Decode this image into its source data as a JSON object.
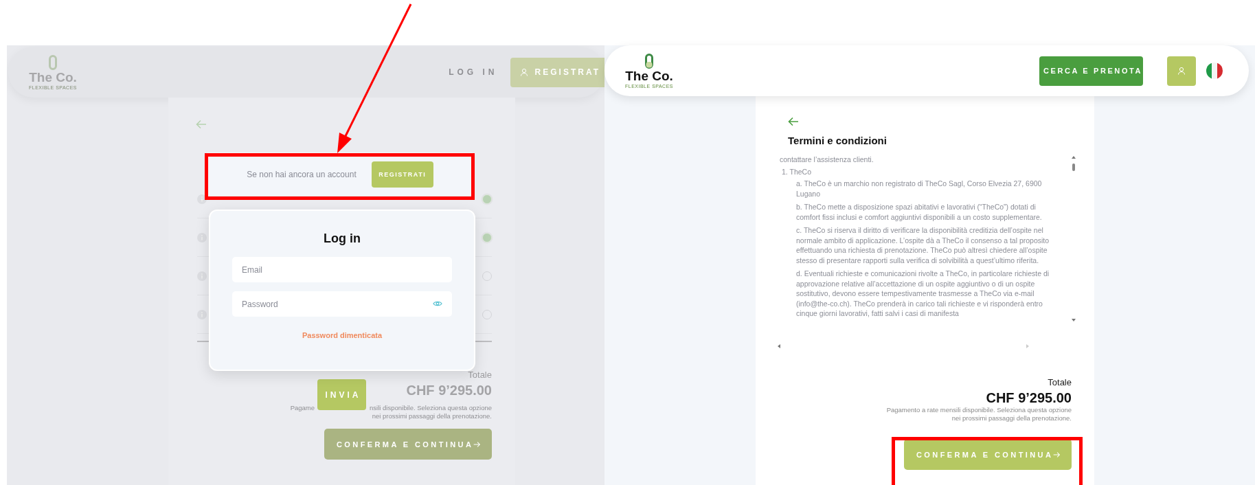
{
  "left_screen": {
    "header": {
      "logo_name": "The Co.",
      "logo_tagline": "FLEXIBLE SPACES",
      "login_link": "LOG IN",
      "register_button": "REGISTRAT"
    },
    "service_options": [
      {
        "checked": true
      },
      {
        "checked": true
      },
      {
        "checked": false
      },
      {
        "checked": false
      }
    ],
    "register_prompt": {
      "text": "Se non hai ancora un account",
      "button": "REGISTRATI"
    },
    "login_dialog": {
      "title": "Log in",
      "email_placeholder": "Email",
      "password_placeholder": "Password",
      "forgot_link": "Password dimenticata"
    },
    "send_button": "INVIA",
    "summary": {
      "total_label": "Totale",
      "total": "CHF 9’295.00",
      "note_parts": [
        "Pagame",
        "nsili disponibile. Seleziona questa opzione"
      ],
      "note_line_2": "nei prossimi passaggi della prenotazione.",
      "confirm_button": "CONFERMA E CONTINUA"
    }
  },
  "right_screen": {
    "header": {
      "logo_name": "The Co.",
      "logo_tagline": "FLEXIBLE SPACES",
      "search_button": "CERCA E PRENOTA"
    },
    "terms": {
      "title": "Termini e condizioni",
      "intro": "contattare l’assistenza clienti.",
      "section": "1. TheCo",
      "clauses": [
        "a. TheCo è un marchio non registrato di TheCo Sagl, Corso Elvezia 27, 6900 Lugano",
        "b. TheCo mette a disposizione spazi abitativi e lavorativi (“TheCo”) dotati di comfort fissi inclusi e comfort aggiuntivi disponibili a un costo supplementare.",
        "c. TheCo si riserva il diritto di verificare la disponibilità creditizia dell’ospite nel normale ambito di applicazione. L’ospite dà a TheCo il consenso a tal proposito effettuando una richiesta di prenotazione. TheCo può altresì chiedere all’ospite stesso di presentare rapporti sulla verifica di solvibilità a quest’ultimo riferita.",
        "d. Eventuali richieste e comunicazioni rivolte a TheCo, in particolare richieste di approvazione relative all’accettazione di un ospite aggiuntivo o di un ospite sostitutivo, devono essere tempestivamente trasmesse a TheCo via e-mail (info@the-co.ch). TheCo prenderà in carico tali richieste e vi risponderà entro cinque giorni lavorativi, fatti salvi i casi di manifesta"
      ]
    },
    "summary": {
      "total_label": "Totale",
      "total": "CHF 9’295.00",
      "note_lines": [
        "Pagamento a rate mensili disponibile. Seleziona questa opzione",
        "nei prossimi passaggi della prenotazione."
      ],
      "confirm_button": "CONFERMA E CONTINUA"
    }
  }
}
